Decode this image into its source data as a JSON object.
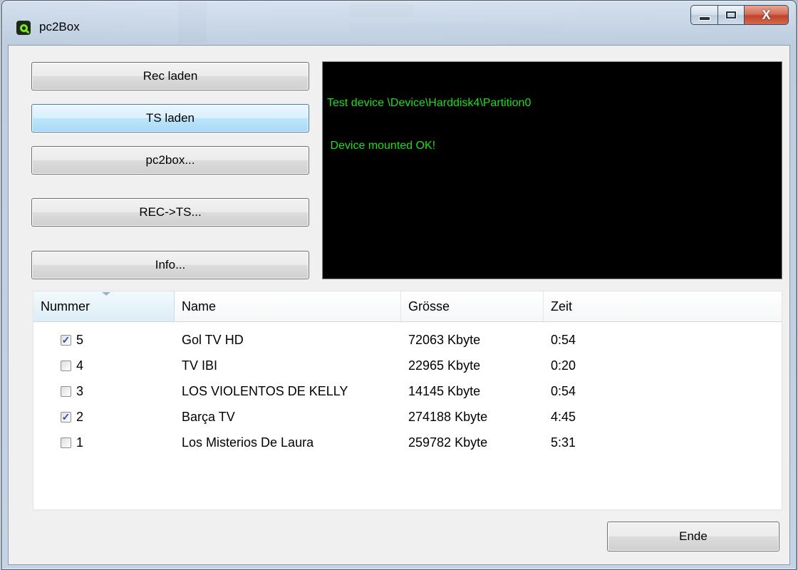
{
  "window": {
    "title": "pc2Box"
  },
  "buttons": {
    "rec_laden": "Rec laden",
    "ts_laden": "TS laden",
    "pc2box": "pc2box...",
    "rec_ts": "REC->TS...",
    "info": "Info...",
    "ende": "Ende"
  },
  "console": {
    "lines": [
      "Test device \\Device\\Harddisk4\\Partition0",
      " Device mounted OK!"
    ],
    "text_color": "#19e019",
    "background": "#000000"
  },
  "list": {
    "columns": [
      "Nummer",
      "Name",
      "Grösse",
      "Zeit"
    ],
    "sorted_column": "Nummer",
    "rows": [
      {
        "checked": true,
        "nummer": "5",
        "name": "Gol TV HD",
        "groesse": "72063 Kbyte",
        "zeit": "0:54"
      },
      {
        "checked": false,
        "nummer": "4",
        "name": "TV IBI",
        "groesse": "22965 Kbyte",
        "zeit": "0:20"
      },
      {
        "checked": false,
        "nummer": "3",
        "name": "LOS VIOLENTOS DE KELLY",
        "groesse": "14145 Kbyte",
        "zeit": "0:54"
      },
      {
        "checked": true,
        "nummer": "2",
        "name": "Barça TV",
        "groesse": "274188 Kbyte",
        "zeit": "4:45"
      },
      {
        "checked": false,
        "nummer": "1",
        "name": "Los Misterios De Laura",
        "groesse": "259782 Kbyte",
        "zeit": "5:31"
      }
    ]
  },
  "icons": {
    "app": "pc2box-logo-icon",
    "minimize": "minimize-icon",
    "maximize": "maximize-icon",
    "close": "close-icon",
    "check": "checkmark-icon"
  },
  "colors": {
    "close_button": "#c7452c",
    "hot_button": "#bee6fd",
    "checkmark": "#2c4f9e"
  }
}
